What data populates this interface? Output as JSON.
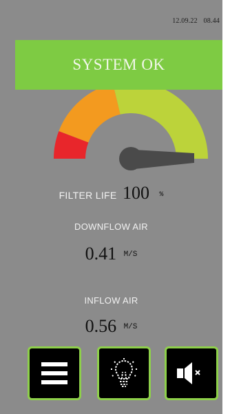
{
  "header": {
    "date": "12.09.22",
    "time": "08.44"
  },
  "status": {
    "text": "SYSTEM OK",
    "color": "#7ecb43"
  },
  "gauge": {
    "value_percent": 100,
    "zone_colors": [
      "#e8262b",
      "#f39a1f",
      "#bcd33a"
    ],
    "needle_color": "#4a4a4a"
  },
  "filter_life": {
    "label": "FILTER LIFE",
    "value": "100",
    "unit": "%"
  },
  "downflow": {
    "label": "DOWNFLOW AIR",
    "value": "0.41",
    "unit": "M/S"
  },
  "inflow": {
    "label": "INFLOW AIR",
    "value": "0.56",
    "unit": "M/S"
  },
  "toolbar": {
    "buttons": [
      {
        "icon": "menu-icon"
      },
      {
        "icon": "lightbulb-icon"
      },
      {
        "icon": "speaker-mute-icon"
      }
    ],
    "border_color": "#8ed04a"
  },
  "colors": {
    "background": "#8b8b8b"
  }
}
